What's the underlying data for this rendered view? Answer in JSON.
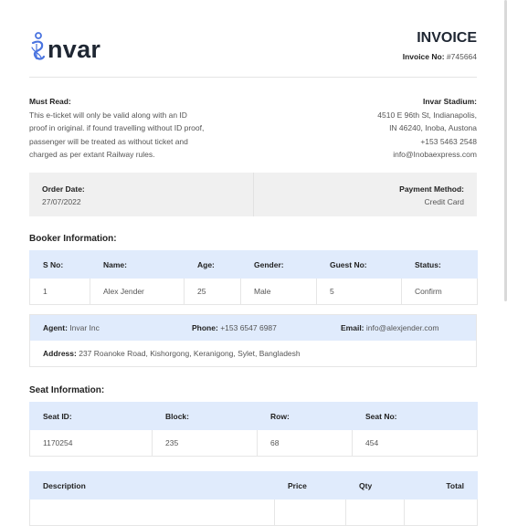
{
  "header": {
    "logo_text": "nvar",
    "title": "INVOICE",
    "invoice_no_label": "Invoice No:",
    "invoice_no": "#745664"
  },
  "notice": {
    "heading": "Must Read:",
    "lines": [
      "This e-ticket will only be valid along with an ID",
      "proof in original. if found travelling without ID proof,",
      "passenger will be treated as without ticket and",
      "charged as per extant Railway rules."
    ]
  },
  "venue": {
    "name": "Invar Stadium:",
    "lines": [
      "4510 E 96th St, Indianapolis,",
      "IN 46240, Inoba, Austona",
      "+153 5463 2548",
      "info@Inobaexpress.com"
    ]
  },
  "order": {
    "date_label": "Order Date:",
    "date": "27/07/2022",
    "payment_label": "Payment Method:",
    "payment": "Credit Card"
  },
  "booker": {
    "title": "Booker Information:",
    "headers": [
      "S No:",
      "Name:",
      "Age:",
      "Gender:",
      "Guest No:",
      "Status:"
    ],
    "row": [
      "1",
      "Alex Jender",
      "25",
      "Male",
      "5",
      "Confirm"
    ]
  },
  "agent": {
    "agent_label": "Agent:",
    "agent": "Invar Inc",
    "phone_label": "Phone:",
    "phone": "+153 6547 6987",
    "email_label": "Email:",
    "email": "info@alexjender.com",
    "address_label": "Address:",
    "address": "237 Roanoke Road, Kishorgong, Keranigong, Sylet, Bangladesh"
  },
  "seat": {
    "title": "Seat Information:",
    "headers": [
      "Seat ID:",
      "Block:",
      "Row:",
      "Seat No:"
    ],
    "row": [
      "1170254",
      "235",
      "68",
      "454"
    ]
  },
  "items": {
    "headers": [
      "Description",
      "Price",
      "Qty",
      "Total"
    ]
  }
}
